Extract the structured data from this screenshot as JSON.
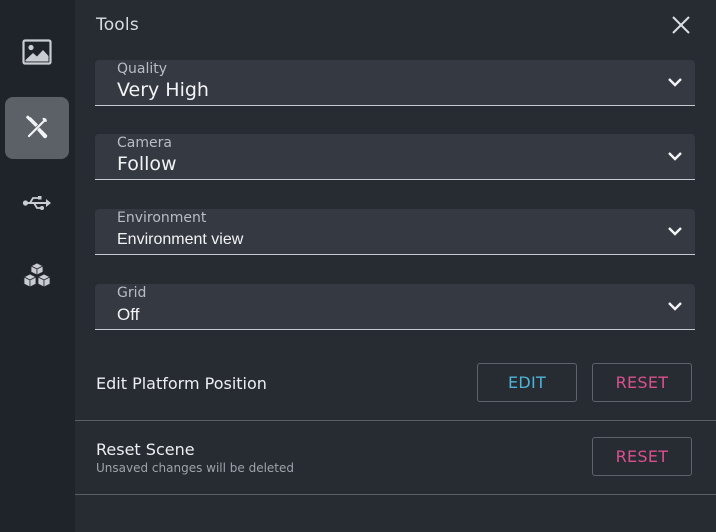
{
  "sidebar": {
    "items": [
      {
        "icon": "image-icon",
        "active": false
      },
      {
        "icon": "tools-icon",
        "active": true
      },
      {
        "icon": "usb-icon",
        "active": false
      },
      {
        "icon": "cubes-icon",
        "active": false
      }
    ]
  },
  "panel": {
    "title": "Tools",
    "close_icon": "close-icon"
  },
  "fields": {
    "quality": {
      "label": "Quality",
      "value": "Very High"
    },
    "camera": {
      "label": "Camera",
      "value": "Follow"
    },
    "environment": {
      "label": "Environment",
      "value": "Environment view"
    },
    "grid": {
      "label": "Grid",
      "value": "Off"
    }
  },
  "platform": {
    "label": "Edit Platform Position",
    "edit_label": "EDIT",
    "reset_label": "RESET"
  },
  "scene": {
    "label": "Reset Scene",
    "sublabel": "Unsaved changes will be deleted",
    "reset_label": "RESET"
  },
  "colors": {
    "accent_edit": "#4fb3d9",
    "accent_reset": "#d9508e",
    "panel_bg": "#272c33",
    "rail_bg": "#1f242b"
  }
}
